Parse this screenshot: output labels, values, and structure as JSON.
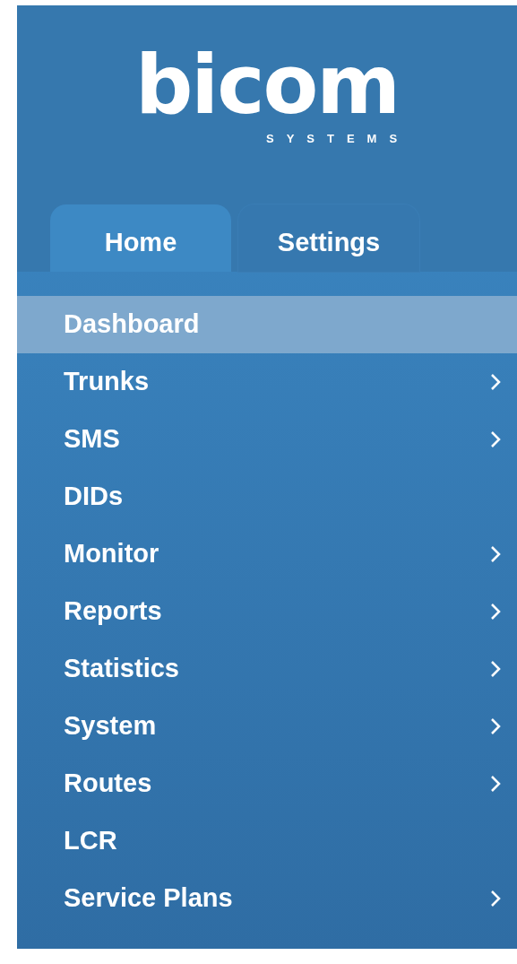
{
  "logo": {
    "name": "bicom",
    "tagline": "SYSTEMS"
  },
  "tabs": [
    {
      "label": "Home",
      "selected": true
    },
    {
      "label": "Settings",
      "selected": false
    }
  ],
  "menu": [
    {
      "label": "Dashboard",
      "selected": true,
      "has_submenu": false
    },
    {
      "label": "Trunks",
      "selected": false,
      "has_submenu": true
    },
    {
      "label": "SMS",
      "selected": false,
      "has_submenu": true
    },
    {
      "label": "DIDs",
      "selected": false,
      "has_submenu": false
    },
    {
      "label": "Monitor",
      "selected": false,
      "has_submenu": true
    },
    {
      "label": "Reports",
      "selected": false,
      "has_submenu": true
    },
    {
      "label": "Statistics",
      "selected": false,
      "has_submenu": true
    },
    {
      "label": "System",
      "selected": false,
      "has_submenu": true
    },
    {
      "label": "Routes",
      "selected": false,
      "has_submenu": true
    },
    {
      "label": "LCR",
      "selected": false,
      "has_submenu": false
    },
    {
      "label": "Service Plans",
      "selected": false,
      "has_submenu": true
    }
  ]
}
